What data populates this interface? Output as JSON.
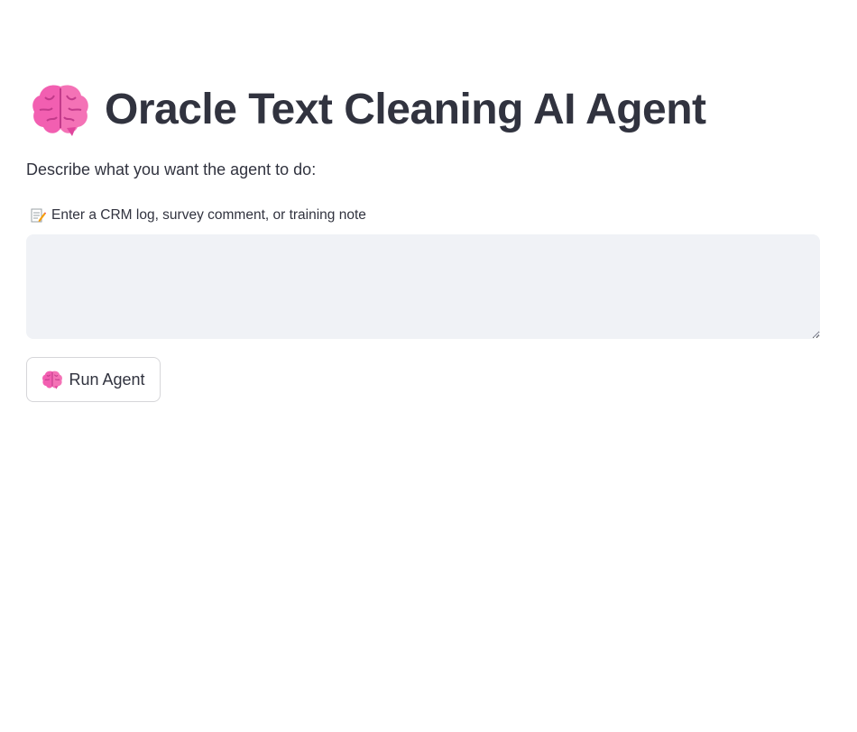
{
  "header": {
    "title": "Oracle Text Cleaning AI Agent",
    "title_icon": "brain-icon"
  },
  "main": {
    "description": "Describe what you want the agent to do:",
    "input": {
      "label": "Enter a CRM log, survey comment, or training note",
      "label_icon": "memo-icon",
      "value": "",
      "placeholder": ""
    },
    "run_button": {
      "label": "Run Agent",
      "icon": "brain-icon"
    }
  },
  "colors": {
    "text": "#31333f",
    "input_bg": "#f0f2f6",
    "button_border": "#d6d6d9",
    "brain_pink": "#f25fb1"
  }
}
